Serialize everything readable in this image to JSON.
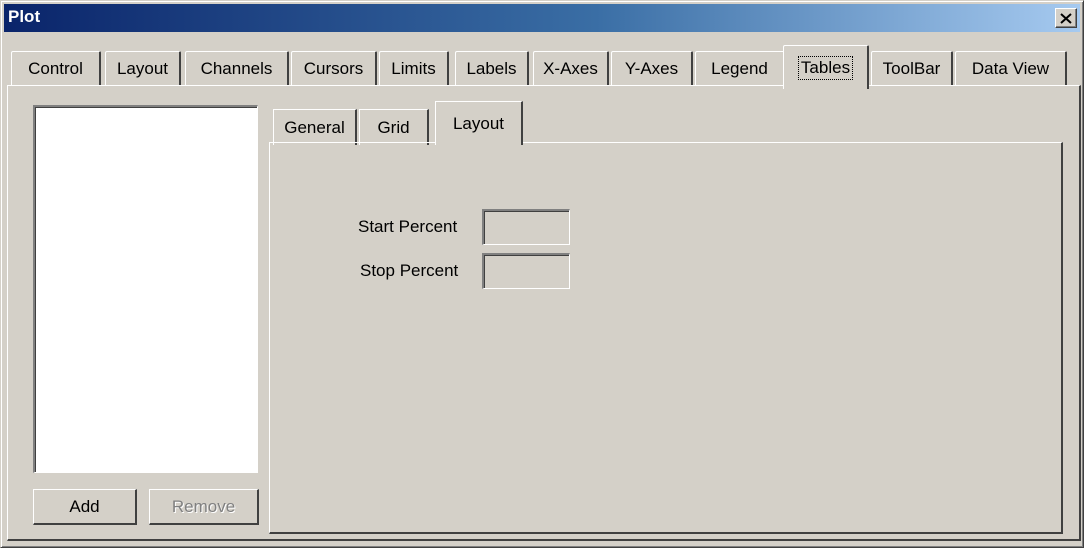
{
  "window": {
    "title": "Plot"
  },
  "tabs": [
    {
      "label": "Control"
    },
    {
      "label": "Layout"
    },
    {
      "label": "Channels"
    },
    {
      "label": "Cursors"
    },
    {
      "label": "Limits"
    },
    {
      "label": "Labels"
    },
    {
      "label": "X-Axes"
    },
    {
      "label": "Y-Axes"
    },
    {
      "label": "Legend"
    },
    {
      "label": "Tables",
      "active": true
    },
    {
      "label": "ToolBar"
    },
    {
      "label": "Data View"
    }
  ],
  "left": {
    "add_label": "Add",
    "remove_label": "Remove"
  },
  "inner_tabs": [
    {
      "label": "General"
    },
    {
      "label": "Grid"
    },
    {
      "label": "Layout",
      "active": true
    }
  ],
  "layout_form": {
    "start_label": "Start Percent",
    "start_value": "",
    "stop_label": "Stop Percent",
    "stop_value": ""
  }
}
